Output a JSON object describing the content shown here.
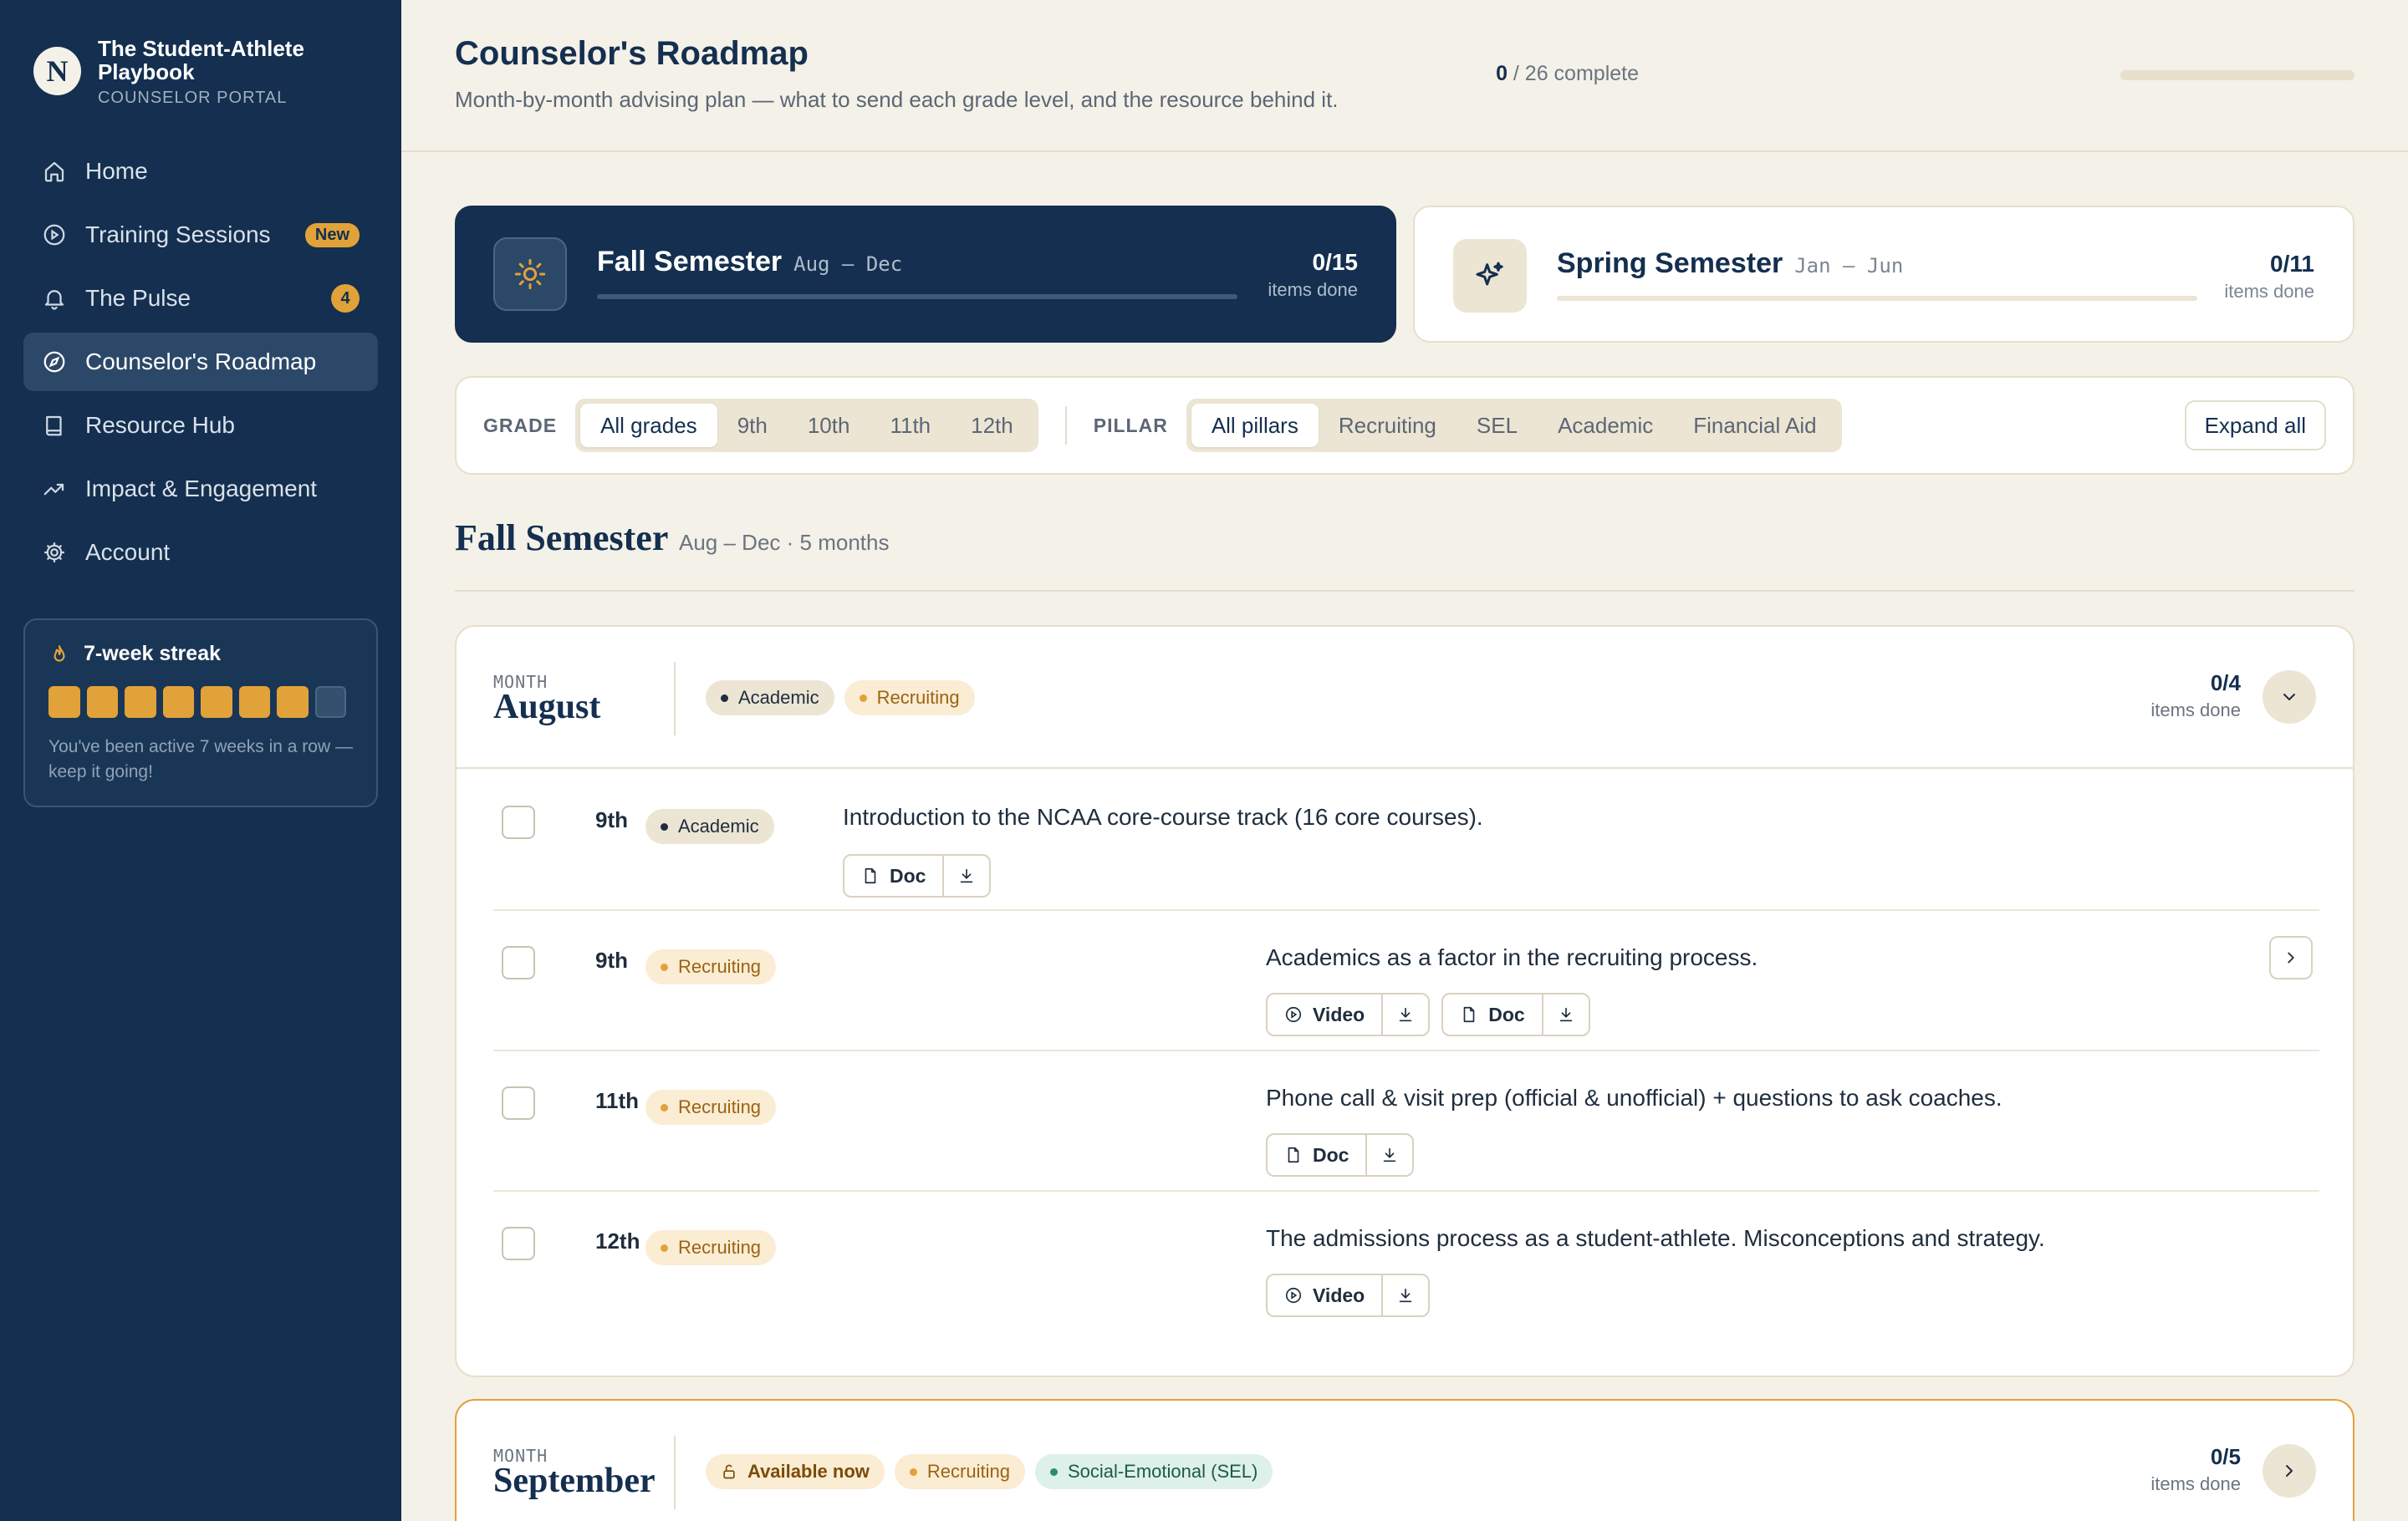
{
  "brand": {
    "initial": "N",
    "title": "The Student-Athlete Playbook",
    "subtitle": "COUNSELOR PORTAL"
  },
  "nav": [
    {
      "label": "Home",
      "icon": "home-icon"
    },
    {
      "label": "Training Sessions",
      "icon": "play-circle-icon",
      "badge": "New"
    },
    {
      "label": "The Pulse",
      "icon": "bell-icon",
      "badge": "4"
    },
    {
      "label": "Counselor's Roadmap",
      "icon": "compass-icon",
      "active": true
    },
    {
      "label": "Resource Hub",
      "icon": "book-icon"
    },
    {
      "label": "Impact & Engagement",
      "icon": "trend-icon"
    },
    {
      "label": "Account",
      "icon": "gear-icon"
    }
  ],
  "streak": {
    "title": "7-week streak",
    "active_weeks": 7,
    "total_weeks": 8,
    "note": "You've been active 7 weeks in a row — keep it going!"
  },
  "header": {
    "title": "Counselor's Roadmap",
    "subtitle": "Month-by-month advising plan — what to send each grade level, and the resource behind it.",
    "progress_done": "0",
    "progress_rest": " / 26 complete",
    "progress_fraction": 0
  },
  "semesters": {
    "fall": {
      "name": "Fall Semester",
      "range": "Aug – Dec",
      "count": "0/15",
      "count_label": "items done",
      "progress": 0
    },
    "spring": {
      "name": "Spring Semester",
      "range": "Jan – Jun",
      "count": "0/11",
      "count_label": "items done",
      "progress": 0
    }
  },
  "filters": {
    "grade_label": "GRADE",
    "grades": [
      "All grades",
      "9th",
      "10th",
      "11th",
      "12th"
    ],
    "pillar_label": "PILLAR",
    "pillars": [
      "All pillars",
      "Recruiting",
      "SEL",
      "Academic",
      "Financial Aid"
    ],
    "expand_label": "Expand all"
  },
  "section": {
    "title": "Fall Semester",
    "meta": "Aug – Dec · 5 months"
  },
  "months": {
    "august": {
      "small": "MONTH",
      "name": "August",
      "tags": [
        "Academic",
        "Recruiting"
      ],
      "count": "0/4",
      "count_label": "items done",
      "items": [
        {
          "grade": "9th",
          "tag": "Academic",
          "text": "Introduction to the NCAA core-course track (16 core courses).",
          "resources": [
            "Doc"
          ]
        },
        {
          "grade": "9th",
          "tag": "Recruiting",
          "text": "Academics as a factor in the recruiting process.",
          "resources": [
            "Video",
            "Doc"
          ]
        },
        {
          "grade": "11th",
          "tag": "Recruiting",
          "text": "Phone call & visit prep (official & unofficial) + questions to ask coaches.",
          "resources": [
            "Doc"
          ]
        },
        {
          "grade": "12th",
          "tag": "Recruiting",
          "text": "The admissions process as a student-athlete. Misconceptions and strategy.",
          "resources": [
            "Video"
          ]
        }
      ]
    },
    "september": {
      "small": "MONTH",
      "name": "September",
      "tags": [
        "Available now",
        "Recruiting",
        "Social-Emotional (SEL)"
      ],
      "count": "0/5",
      "count_label": "items done"
    }
  },
  "colors": {
    "navy": "#142f4f",
    "accent": "#e2a23a",
    "background": "#f4f1e8"
  }
}
